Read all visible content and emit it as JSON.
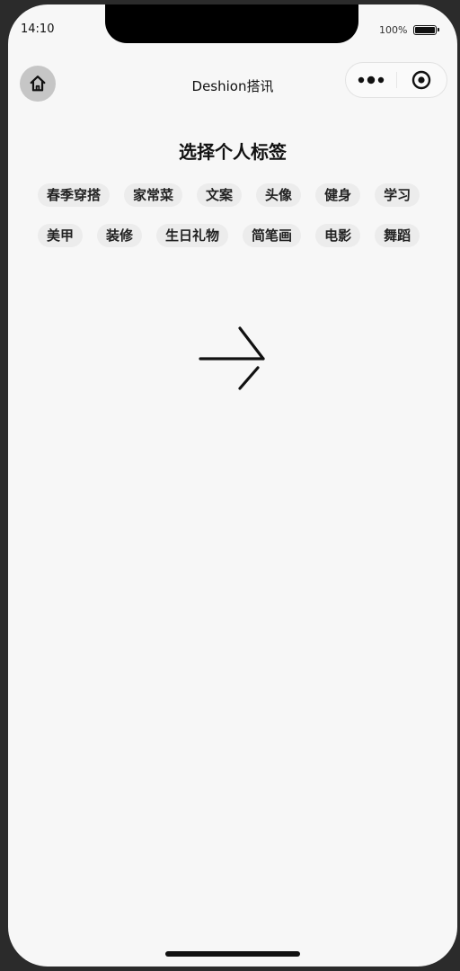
{
  "status_bar": {
    "time": "14:10",
    "battery_percent": "100%",
    "battery_level": 1.0
  },
  "nav": {
    "home_icon": "home-icon",
    "title": "Deshion搭讯",
    "capsule": {
      "more_icon": "more-dots-icon",
      "close_icon": "target-circle-icon"
    }
  },
  "main": {
    "heading": "选择个人标签",
    "tags": [
      "春季穿搭",
      "家常菜",
      "文案",
      "头像",
      "健身",
      "学习",
      "美甲",
      "装修",
      "生日礼物",
      "简笔画",
      "电影",
      "舞蹈"
    ],
    "next_icon": "arrow-right-icon"
  },
  "colors": {
    "background": "#f7f7f7",
    "tag_background": "#ececec",
    "home_button": "#c6c6c6"
  }
}
